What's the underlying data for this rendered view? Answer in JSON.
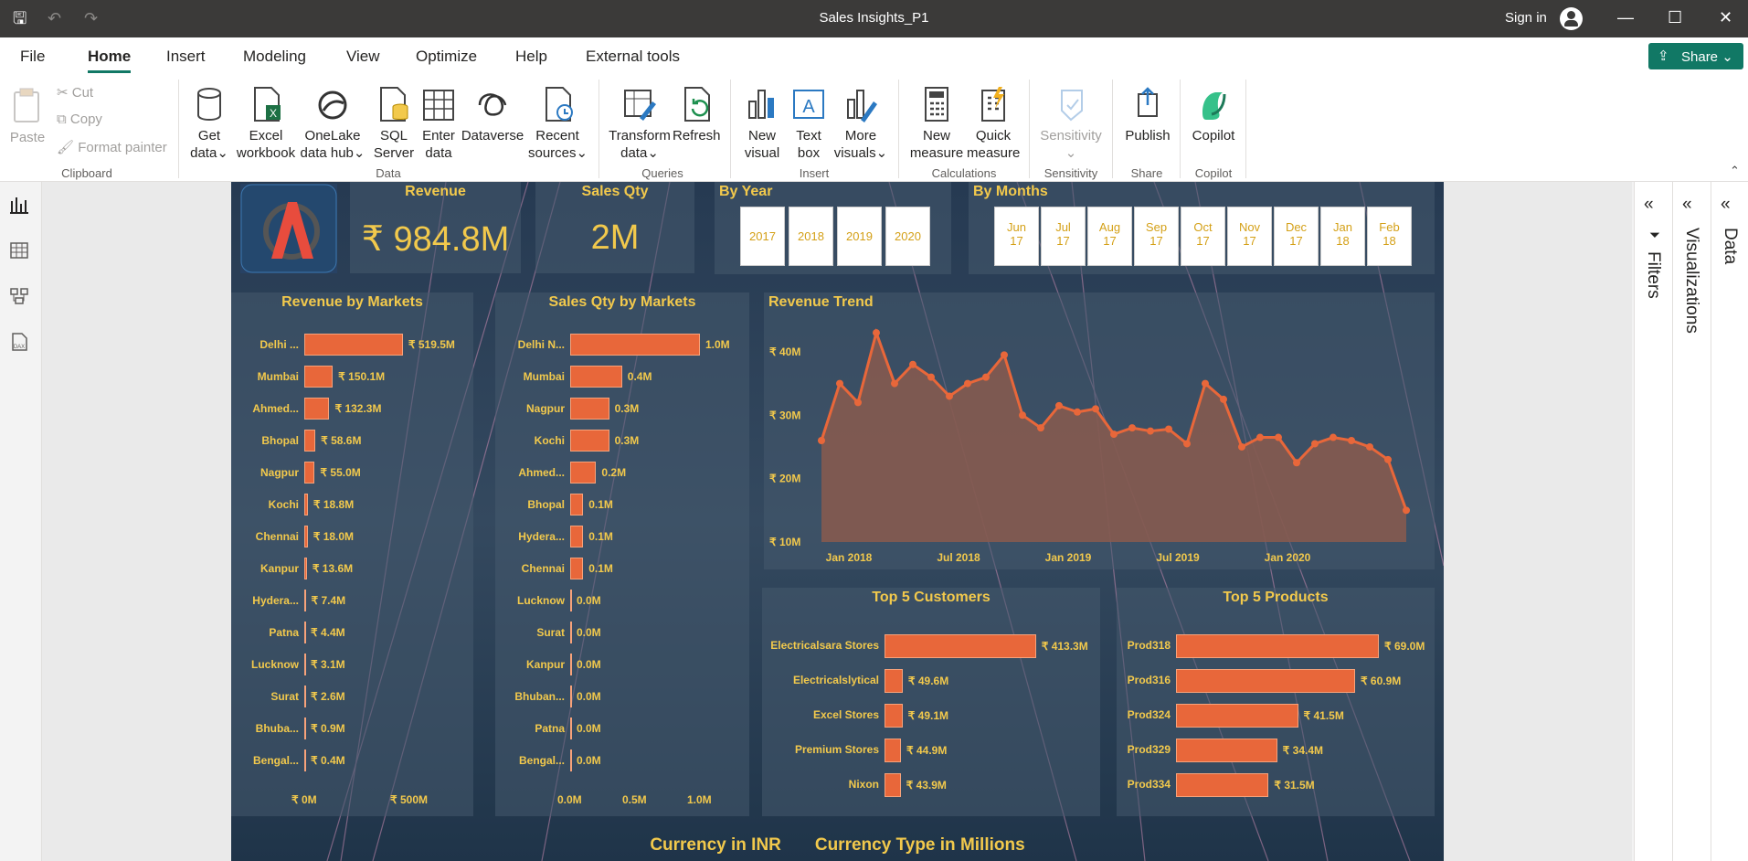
{
  "window": {
    "title": "Sales Insights_P1",
    "sign_in": "Sign in"
  },
  "menu": {
    "items": [
      "File",
      "Home",
      "Insert",
      "Modeling",
      "View",
      "Optimize",
      "Help",
      "External tools"
    ],
    "active": "Home",
    "share": "Share"
  },
  "ribbon": {
    "clipboard": {
      "paste": "Paste",
      "cut": "Cut",
      "copy": "Copy",
      "format_painter": "Format painter",
      "label": "Clipboard"
    },
    "data": {
      "get_data": [
        "Get",
        "data"
      ],
      "excel": [
        "Excel",
        "workbook"
      ],
      "onelake": [
        "OneLake",
        "data hub"
      ],
      "sql": [
        "SQL",
        "Server"
      ],
      "enter": [
        "Enter",
        "data"
      ],
      "dataverse": "Dataverse",
      "recent": [
        "Recent",
        "sources"
      ],
      "label": "Data"
    },
    "queries": {
      "transform": [
        "Transform",
        "data"
      ],
      "refresh": "Refresh",
      "label": "Queries"
    },
    "insert": {
      "new_visual": [
        "New",
        "visual"
      ],
      "text_box": [
        "Text",
        "box"
      ],
      "more_visuals": [
        "More",
        "visuals"
      ],
      "label": "Insert"
    },
    "calculations": {
      "new_measure": [
        "New",
        "measure"
      ],
      "quick_measure": [
        "Quick",
        "measure"
      ],
      "label": "Calculations"
    },
    "sensitivity": {
      "btn": "Sensitivity",
      "label": "Sensitivity"
    },
    "share": {
      "publish": "Publish",
      "label": "Share"
    },
    "copilot": {
      "btn": "Copilot",
      "label": "Copilot"
    }
  },
  "panes": {
    "filters": "Filters",
    "visualizations": "Visualizations",
    "data": "Data"
  },
  "report": {
    "revenue_title": "Revenue",
    "revenue_value": "₹ 984.8M",
    "qty_title": "Sales Qty",
    "qty_value": "2M",
    "year_title": "By Year",
    "years": [
      "2017",
      "2018",
      "2019",
      "2020"
    ],
    "month_title": "By Months",
    "months": [
      [
        "Jun",
        "17"
      ],
      [
        "Jul",
        "17"
      ],
      [
        "Aug",
        "17"
      ],
      [
        "Sep",
        "17"
      ],
      [
        "Oct",
        "17"
      ],
      [
        "Nov",
        "17"
      ],
      [
        "Dec",
        "17"
      ],
      [
        "Jan",
        "18"
      ],
      [
        "Feb",
        "18"
      ]
    ],
    "footer_currency": "Currency in INR",
    "footer_type": "Currency Type in Millions"
  },
  "chart_data": [
    {
      "type": "bar",
      "title": "Revenue by Markets",
      "orientation": "horizontal",
      "categories": [
        "Delhi ...",
        "Mumbai",
        "Ahmed...",
        "Bhopal",
        "Nagpur",
        "Kochi",
        "Chennai",
        "Kanpur",
        "Hydera...",
        "Patna",
        "Lucknow",
        "Surat",
        "Bhuba...",
        "Bengal..."
      ],
      "values": [
        519.5,
        150.1,
        132.3,
        58.6,
        55.0,
        18.8,
        18.0,
        13.6,
        7.4,
        4.4,
        3.1,
        2.6,
        0.9,
        0.4
      ],
      "labels": [
        "₹ 519.5M",
        "₹ 150.1M",
        "₹ 132.3M",
        "₹ 58.6M",
        "₹ 55.0M",
        "₹ 18.8M",
        "₹ 18.0M",
        "₹ 13.6M",
        "₹ 7.4M",
        "₹ 4.4M",
        "₹ 3.1M",
        "₹ 2.6M",
        "₹ 0.9M",
        "₹ 0.4M"
      ],
      "xticks": [
        "₹ 0M",
        "₹ 500M"
      ],
      "xlim": [
        0,
        520
      ]
    },
    {
      "type": "bar",
      "title": "Sales Qty by Markets",
      "orientation": "horizontal",
      "categories": [
        "Delhi N...",
        "Mumbai",
        "Nagpur",
        "Kochi",
        "Ahmed...",
        "Bhopal",
        "Hydera...",
        "Chennai",
        "Lucknow",
        "Surat",
        "Kanpur",
        "Bhuban...",
        "Patna",
        "Bengal..."
      ],
      "values": [
        1.0,
        0.4,
        0.3,
        0.3,
        0.2,
        0.1,
        0.1,
        0.1,
        0.0,
        0.0,
        0.0,
        0.0,
        0.0,
        0.0
      ],
      "labels": [
        "1.0M",
        "0.4M",
        "0.3M",
        "0.3M",
        "0.2M",
        "0.1M",
        "0.1M",
        "0.1M",
        "0.0M",
        "0.0M",
        "0.0M",
        "0.0M",
        "0.0M",
        "0.0M"
      ],
      "xticks": [
        "0.0M",
        "0.5M",
        "1.0M"
      ],
      "xlim": [
        0,
        1.0
      ]
    },
    {
      "type": "area",
      "title": "Revenue Trend",
      "y": [
        26,
        35,
        32,
        43,
        35,
        38,
        36,
        33,
        35,
        36,
        39.5,
        30,
        28,
        31.5,
        30.5,
        31,
        27,
        28,
        27.5,
        27.8,
        25.5,
        35,
        32.5,
        25,
        26.5,
        26.5,
        22.5,
        25.5,
        26.5,
        26,
        25,
        23,
        15
      ],
      "xticks": [
        "Jan 2018",
        "Jul 2018",
        "Jan 2019",
        "Jul 2019",
        "Jan 2020"
      ],
      "yticks": [
        "₹ 10M",
        "₹ 20M",
        "₹ 30M",
        "₹ 40M"
      ],
      "ylim": [
        10,
        42
      ]
    },
    {
      "type": "bar",
      "title": "Top 5 Customers",
      "orientation": "horizontal",
      "categories": [
        "Electricalsara Stores",
        "Electricalslytical",
        "Excel Stores",
        "Premium Stores",
        "Nixon"
      ],
      "values": [
        413.3,
        49.6,
        49.1,
        44.9,
        43.9
      ],
      "labels": [
        "₹ 413.3M",
        "₹ 49.6M",
        "₹ 49.1M",
        "₹ 44.9M",
        "₹ 43.9M"
      ],
      "xlim": [
        0,
        414
      ]
    },
    {
      "type": "bar",
      "title": "Top 5 Products",
      "orientation": "horizontal",
      "categories": [
        "Prod318",
        "Prod316",
        "Prod324",
        "Prod329",
        "Prod334"
      ],
      "values": [
        69.0,
        60.9,
        41.5,
        34.4,
        31.5
      ],
      "labels": [
        "₹ 69.0M",
        "₹ 60.9M",
        "₹ 41.5M",
        "₹ 34.4M",
        "₹ 31.5M"
      ],
      "xlim": [
        0,
        69
      ]
    }
  ]
}
